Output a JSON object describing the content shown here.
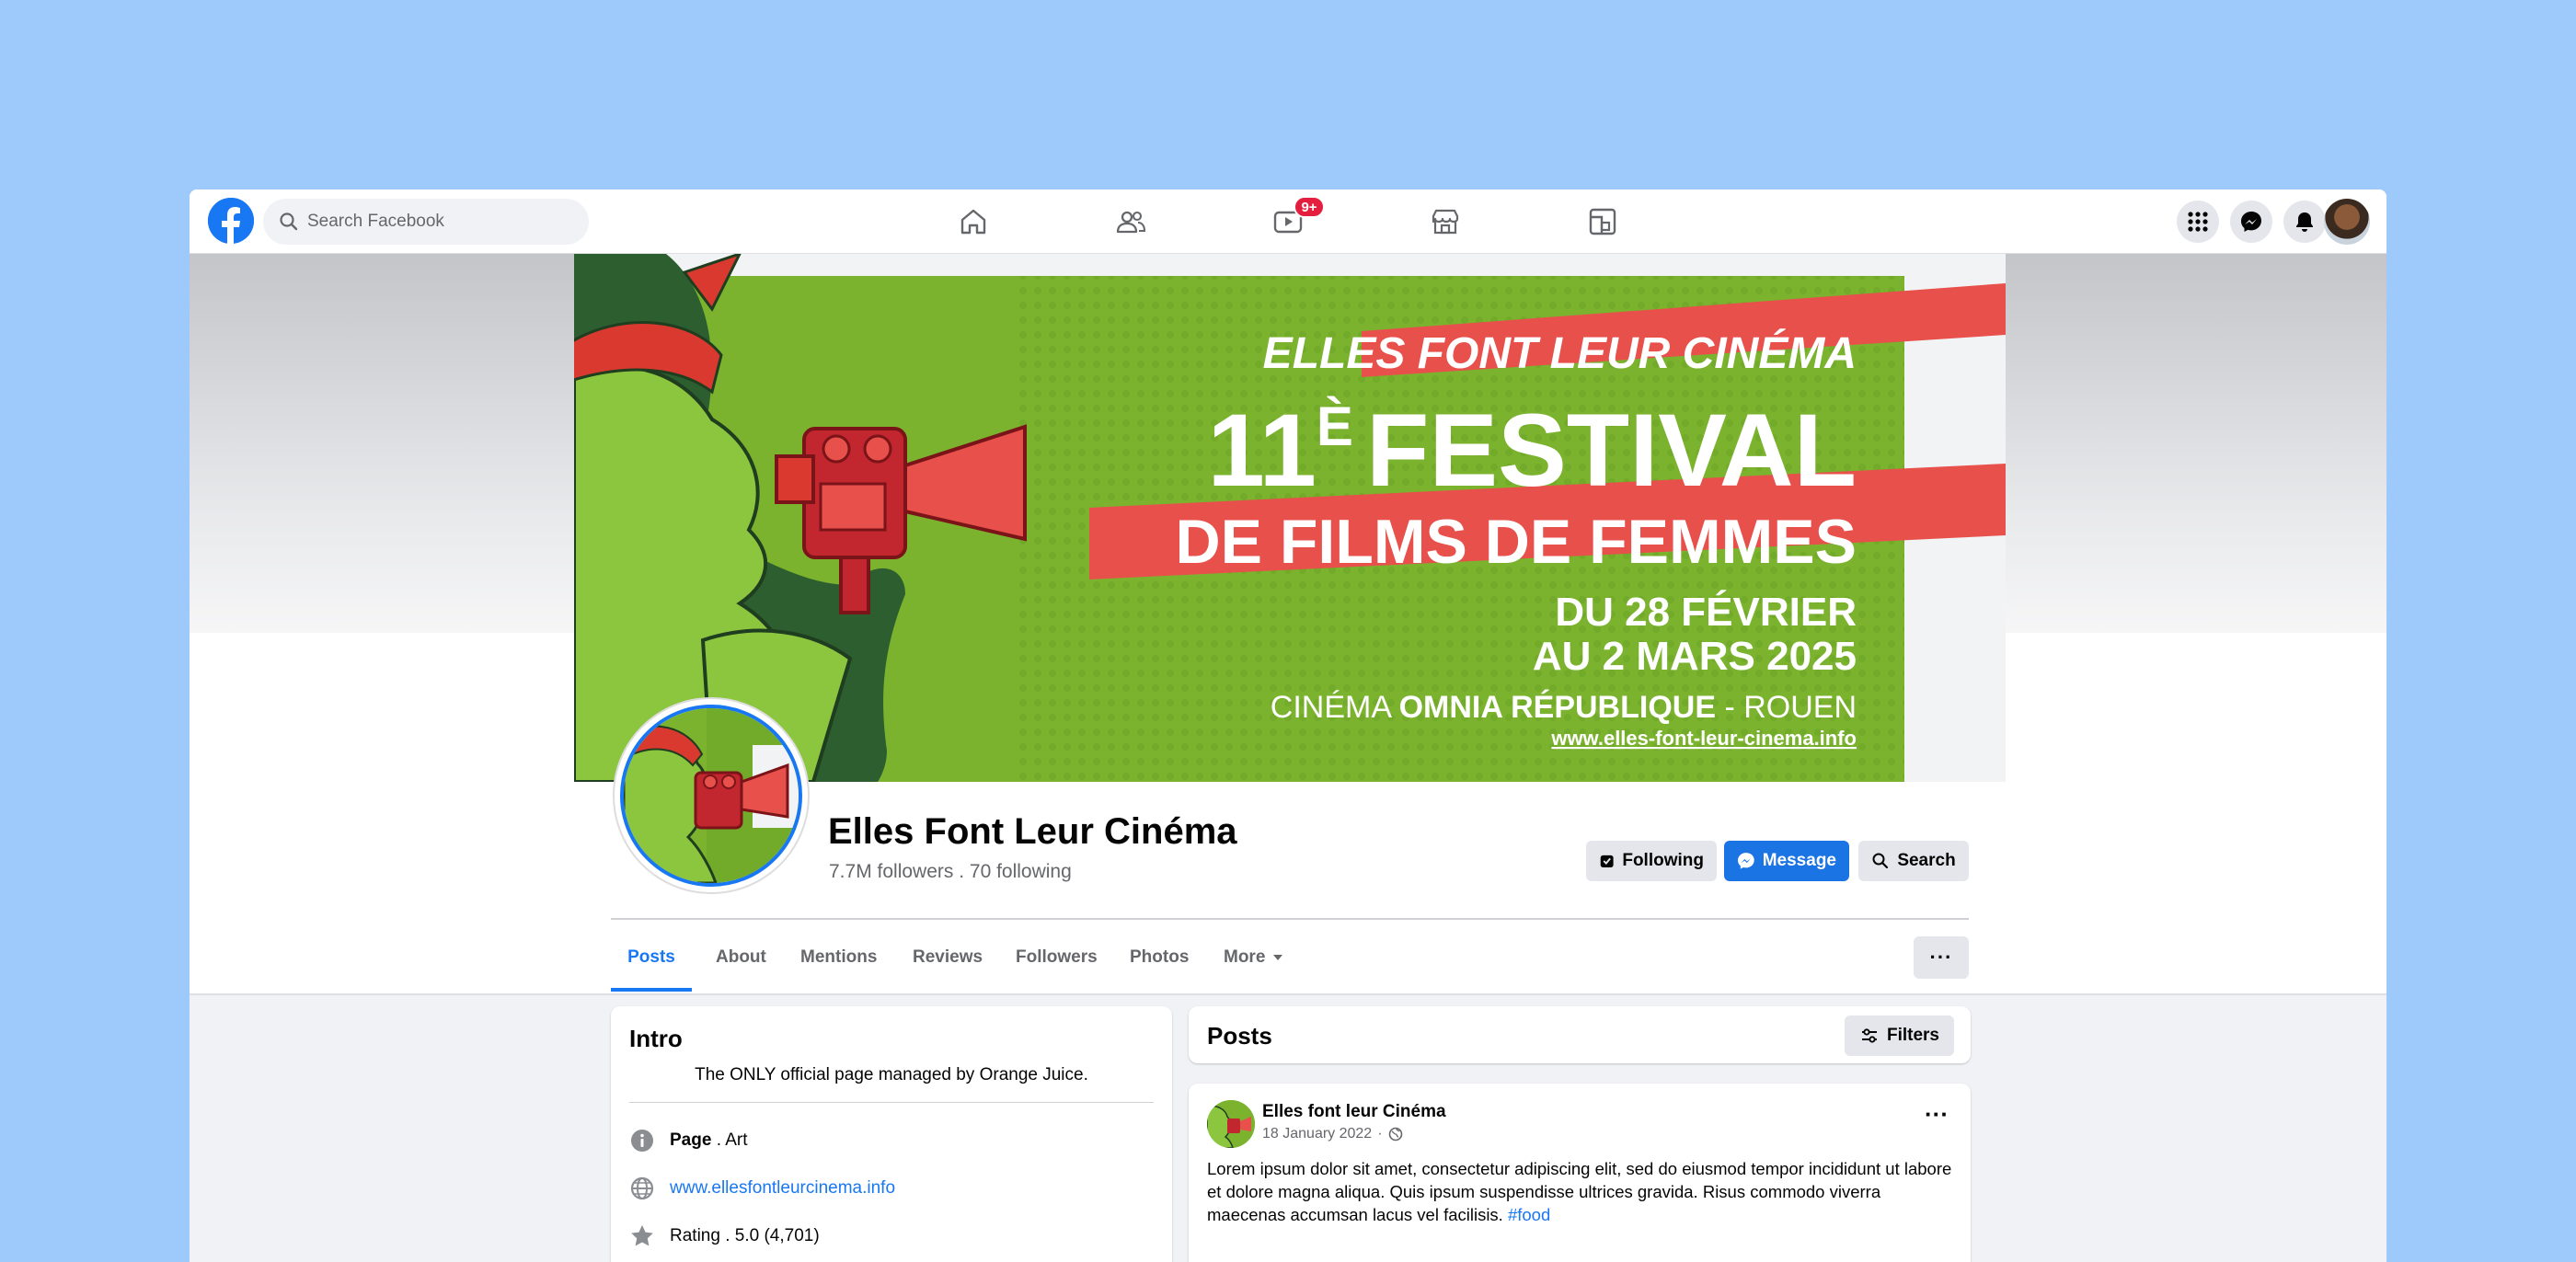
{
  "topbar": {
    "search_placeholder": "Search Facebook",
    "nav_icons": [
      "home-icon",
      "friends-icon",
      "watch-icon",
      "marketplace-icon",
      "gaming-icon"
    ],
    "watch_badge": "9+",
    "right_icons": [
      "menu-grid-icon",
      "messenger-icon",
      "notifications-icon"
    ]
  },
  "cover": {
    "headline_top": "ELLES FONT LEUR CINÉMA",
    "festival_number": "11",
    "festival_number_sup": "È",
    "festival_word": "FESTIVAL",
    "subtitle": "DE FILMS DE FEMMES",
    "dates_line1": "DU 28 FÉVRIER",
    "dates_line2": "AU 2 MARS 2025",
    "venue_prefix": "CINÉMA ",
    "venue_bold": "OMNIA RÉPUBLIQUE",
    "venue_suffix": " - ROUEN",
    "url": "www.elles-font-leur-cinema.info"
  },
  "profile": {
    "name": "Elles Font Leur Cinéma",
    "followers": "7.7M followers . 70 following",
    "following_label": "Following",
    "message_label": "Message",
    "search_label": "Search",
    "more_dots": "···"
  },
  "tabs": [
    "Posts",
    "About",
    "Mentions",
    "Reviews",
    "Followers",
    "Photos",
    "More"
  ],
  "intro": {
    "title": "Intro",
    "bio": "The ONLY official page managed by Orange Juice.",
    "category_bold": "Page",
    "category_rest": " . Art",
    "website": "www.ellesfontleurcinema.info",
    "rating": "Rating . 5.0 (4,701)"
  },
  "posts": {
    "title": "Posts",
    "filters_label": "Filters",
    "author": "Elles font leur Cinéma",
    "date": "18 January 2022",
    "meta_sep": "·",
    "more": "···",
    "text": "Lorem ipsum dolor sit amet, consectetur adipiscing elit, sed do eiusmod tempor incididunt ut labore et dolore magna aliqua. Quis ipsum suspendisse ultrices gravida. Risus commodo viverra maecenas accumsan lacus vel facilisis. ",
    "hashtag": "#food"
  },
  "colors": {
    "accent": "#1877f2",
    "cover_green": "#7bb32e",
    "cover_red": "#e8504b",
    "badge_red": "#e41e3f"
  }
}
